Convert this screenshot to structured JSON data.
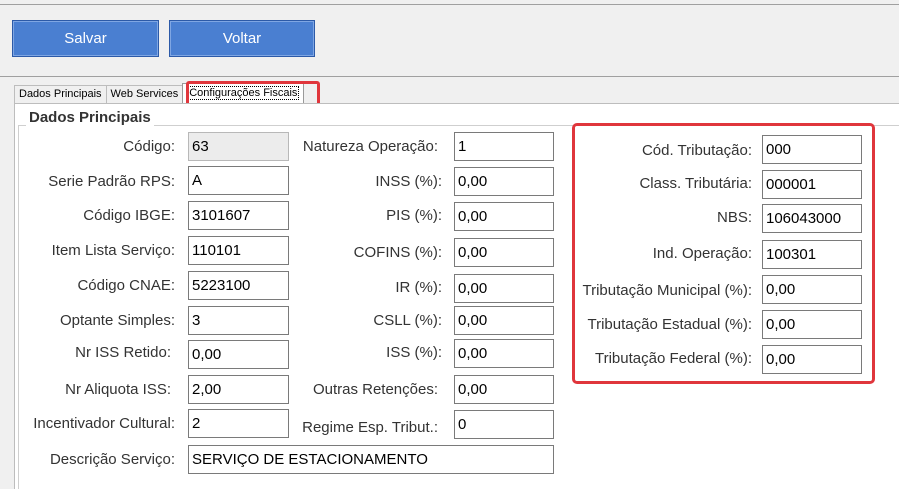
{
  "toolbar": {
    "save_label": "Salvar",
    "back_label": "Voltar"
  },
  "tabs": [
    {
      "label": "Dados Principais"
    },
    {
      "label": "Web Services"
    },
    {
      "label": "Configurações Fiscais"
    }
  ],
  "group": {
    "title": "Dados Principais"
  },
  "col1": [
    {
      "label": "Código:",
      "value": "63"
    },
    {
      "label": "Serie Padrão RPS:",
      "value": "A"
    },
    {
      "label": "Código IBGE:",
      "value": "3101607"
    },
    {
      "label": "Item Lista Serviço:",
      "value": "110101"
    },
    {
      "label": "Código CNAE:",
      "value": "5223100"
    },
    {
      "label": "Optante Simples:",
      "value": "3"
    },
    {
      "label": "Nr ISS Retido:",
      "value": "0,00"
    },
    {
      "label": "Nr Aliquota ISS:",
      "value": "2,00"
    },
    {
      "label": "Incentivador Cultural:",
      "value": "2"
    }
  ],
  "col2": [
    {
      "label": "Natureza Operação:",
      "value": "1"
    },
    {
      "label": "INSS (%):",
      "value": "0,00"
    },
    {
      "label": "PIS (%):",
      "value": "0,00"
    },
    {
      "label": "COFINS (%):",
      "value": "0,00"
    },
    {
      "label": "IR (%):",
      "value": "0,00"
    },
    {
      "label": "CSLL (%):",
      "value": "0,00"
    },
    {
      "label": "ISS (%):",
      "value": "0,00"
    },
    {
      "label": "Outras Retenções:",
      "value": "0,00"
    },
    {
      "label": "Regime Esp. Tribut.:",
      "value": "0"
    }
  ],
  "description": {
    "label": "Descrição Serviço:",
    "value": "SERVIÇO DE ESTACIONAMENTO"
  },
  "fiscal": [
    {
      "label": "Cód. Tributação:",
      "value": "000"
    },
    {
      "label": "Class. Tributária:",
      "value": "000001"
    },
    {
      "label": "NBS:",
      "value": "106043000"
    },
    {
      "label": "Ind. Operação:",
      "value": "100301"
    },
    {
      "label": "Tributação Municipal (%):",
      "value": "0,00"
    },
    {
      "label": "Tributação Estadual (%):",
      "value": "0,00"
    },
    {
      "label": "Tributação Federal (%):",
      "value": "0,00"
    }
  ],
  "colors": {
    "button": "#4a7fd1",
    "highlight": "#e0363c"
  }
}
